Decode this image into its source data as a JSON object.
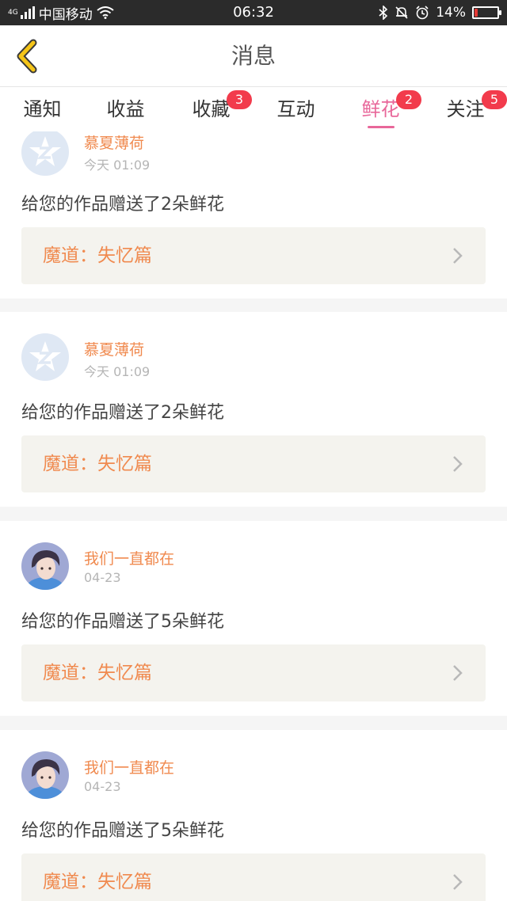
{
  "status_bar": {
    "network_tag": "4G",
    "carrier": "中国移动",
    "time": "06:32",
    "battery_percent": "14%",
    "battery_level": 0.14,
    "battery_color": "#e53935"
  },
  "header": {
    "title": "消息",
    "back_icon": "chevron-left-icon",
    "back_color": "#f5c518"
  },
  "tabs": [
    {
      "label": "通知",
      "badge": "",
      "active": false
    },
    {
      "label": "收益",
      "badge": "",
      "active": false
    },
    {
      "label": "收藏",
      "badge": "3",
      "active": false
    },
    {
      "label": "互动",
      "badge": "",
      "active": false
    },
    {
      "label": "鲜花",
      "badge": "2",
      "active": true
    },
    {
      "label": "关注",
      "badge": "5",
      "active": false
    }
  ],
  "colors": {
    "accent": "#e8679a",
    "badge": "#f23b4c",
    "username": "#f08a4f",
    "work_link_bg": "#f4f3ee"
  },
  "feed": [
    {
      "username": "慕夏薄荷",
      "time": "今天 01:09",
      "message": "给您的作品赠送了2朵鲜花",
      "work_title": "魔道：失忆篇",
      "avatar": "default-avatar-icon"
    },
    {
      "username": "慕夏薄荷",
      "time": "今天 01:09",
      "message": "给您的作品赠送了2朵鲜花",
      "work_title": "魔道：失忆篇",
      "avatar": "default-avatar-icon"
    },
    {
      "username": "我们一直都在",
      "time": "04-23",
      "message": "给您的作品赠送了5朵鲜花",
      "work_title": "魔道：失忆篇",
      "avatar": "user-photo"
    },
    {
      "username": "我们一直都在",
      "time": "04-23",
      "message": "给您的作品赠送了5朵鲜花",
      "work_title": "魔道：失忆篇",
      "avatar": "user-photo"
    }
  ]
}
